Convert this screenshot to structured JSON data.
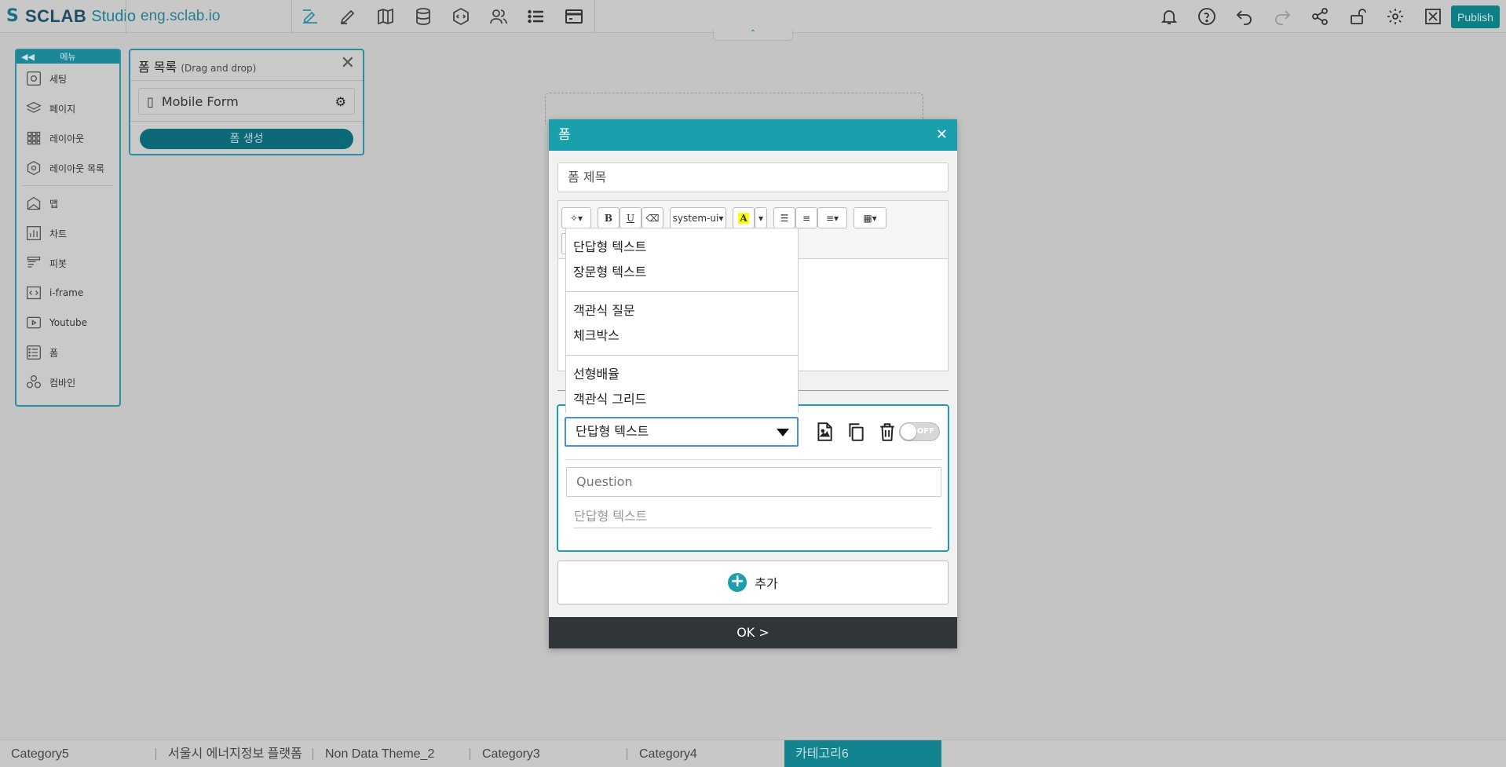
{
  "topbar": {
    "brand": "SCLAB",
    "studio": "Studio",
    "domain": "eng.sclab.io",
    "publish_label": "Publish",
    "icons_left": [
      "dashboard-edit-icon",
      "pencil-icon",
      "map-book-icon",
      "database-icon",
      "code-icon",
      "users-icon",
      "list-icon",
      "card-icon"
    ],
    "icons_right": [
      "bell-icon",
      "help-icon",
      "undo-icon",
      "redo-icon",
      "share-icon",
      "unlock-icon",
      "gear-icon",
      "fullscreen-icon"
    ]
  },
  "menu": {
    "title": "메뉴",
    "items": [
      {
        "label": "세팅",
        "icon": "settings-icon"
      },
      {
        "label": "페이지",
        "icon": "layers-icon"
      },
      {
        "label": "레이아웃",
        "icon": "grid-icon"
      },
      {
        "label": "레이아웃 목록",
        "icon": "layout-list-icon"
      },
      {
        "label": "맵",
        "icon": "map-icon"
      },
      {
        "label": "차트",
        "icon": "chart-icon"
      },
      {
        "label": "피봇",
        "icon": "pivot-icon"
      },
      {
        "label": "i-frame",
        "icon": "iframe-icon"
      },
      {
        "label": "Youtube",
        "icon": "youtube-icon"
      },
      {
        "label": "폼",
        "icon": "form-icon"
      },
      {
        "label": "컴바인",
        "icon": "combine-icon"
      }
    ]
  },
  "formlist": {
    "title": "폼 목록",
    "subtitle": "(Drag and drop)",
    "item_label": "Mobile Form",
    "create_label": "폼 생성"
  },
  "modal": {
    "title": "폼",
    "form_title_placeholder": "폼 제목",
    "font_label": "system-ui",
    "question_type_selected": "단답형 텍스트",
    "question_placeholder": "Question",
    "answer_placeholder": "단답형 텍스트",
    "toggle_label": "OFF",
    "add_label": "추가",
    "ok_label": "OK >"
  },
  "dropdown": {
    "group1": [
      "단답형 텍스트",
      "장문형 텍스트"
    ],
    "group2": [
      "객관식 질문",
      "체크박스"
    ],
    "group3": [
      "선형배율",
      "객관식 그리드"
    ]
  },
  "bottombar": {
    "tabs": [
      "Category5",
      "서울시 에너지정보 플랫폼",
      "Non Data Theme_2",
      "Category3",
      "Category4",
      "카테고리6"
    ]
  }
}
